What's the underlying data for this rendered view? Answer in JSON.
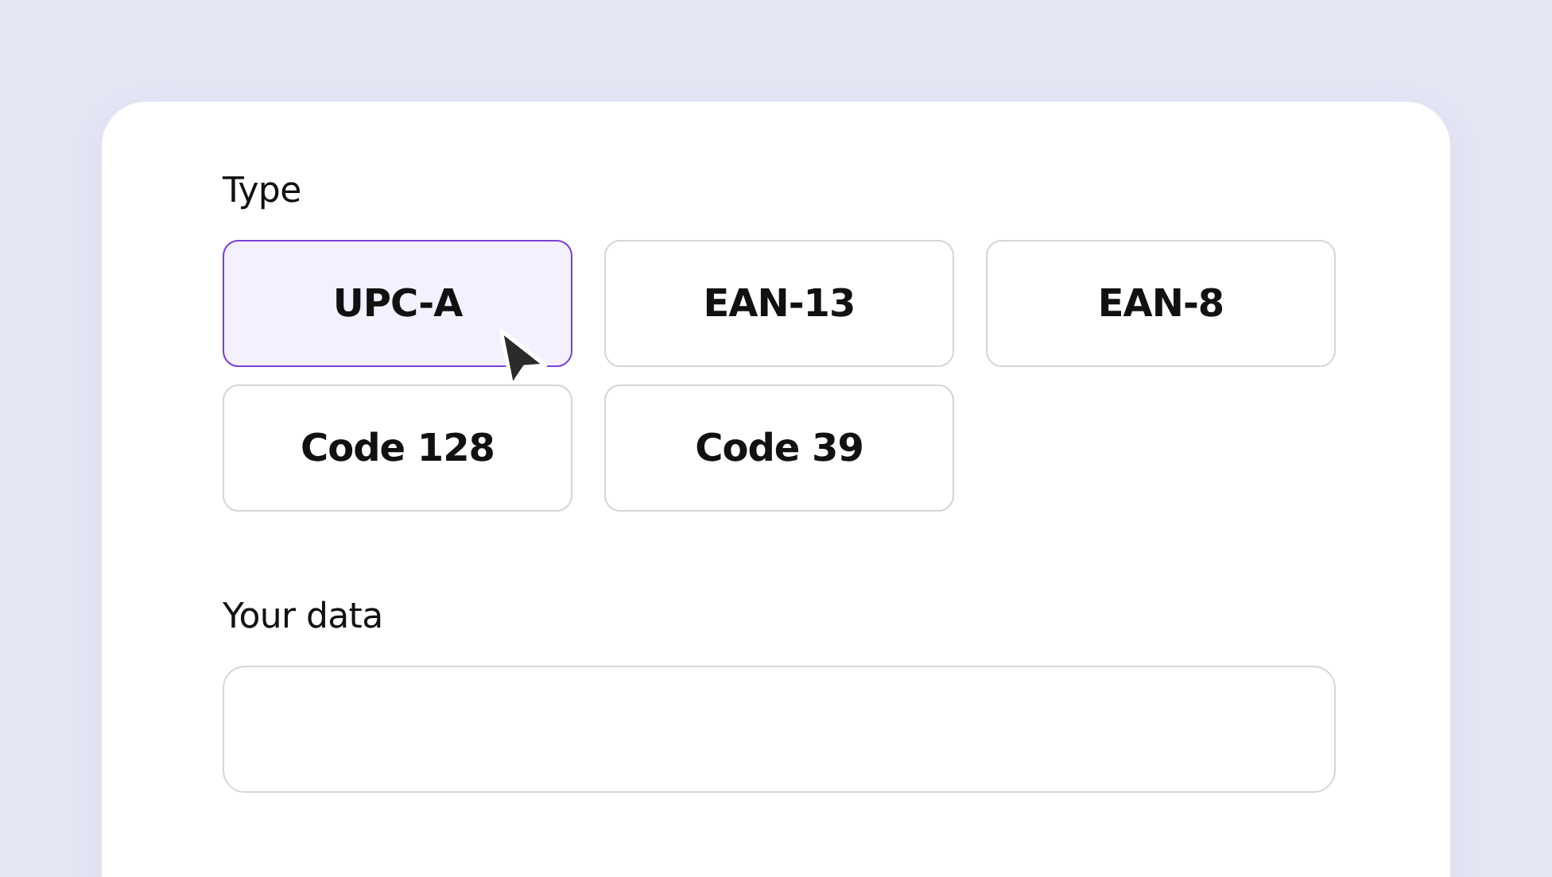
{
  "type_label": "Type",
  "types": [
    {
      "label": "UPC-A",
      "selected": true
    },
    {
      "label": "EAN-13",
      "selected": false
    },
    {
      "label": "EAN-8",
      "selected": false
    },
    {
      "label": "Code 128",
      "selected": false
    },
    {
      "label": "Code 39",
      "selected": false
    }
  ],
  "data_field": {
    "label": "Your data"
  }
}
